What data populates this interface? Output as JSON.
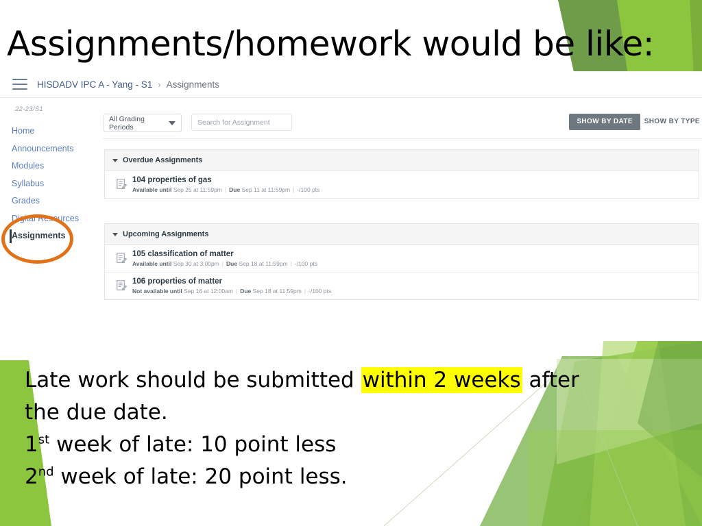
{
  "slide": {
    "title": "Assignments/homework would be like:",
    "accent_green_dark": "#6b9b47",
    "accent_green_light": "#8cc63f",
    "highlight_color": "#FFFF00",
    "annotation_color": "#E2721A"
  },
  "screenshot": {
    "breadcrumb": {
      "menu_icon": "hamburger-icon",
      "course": "HISDADV IPC A - Yang - S1",
      "separator": "›",
      "current": "Assignments"
    },
    "sidebar": {
      "term": "22-23/S1",
      "items": [
        {
          "label": "Home",
          "active": false
        },
        {
          "label": "Announcements",
          "active": false
        },
        {
          "label": "Modules",
          "active": false
        },
        {
          "label": "Syllabus",
          "active": false
        },
        {
          "label": "Grades",
          "active": false
        },
        {
          "label": "Digital Resources",
          "active": false
        },
        {
          "label": "Assignments",
          "active": true
        }
      ]
    },
    "toolbar": {
      "grading_period_value": "All Grading Periods",
      "search_placeholder": "Search for Assignment",
      "show_by_date": "SHOW BY DATE",
      "show_by_type": "SHOW BY TYPE",
      "active_view": "SHOW BY DATE"
    },
    "groups": [
      {
        "title": "Overdue Assignments",
        "rows": [
          {
            "name": "104 properties of gas",
            "available_label": "Available until",
            "available_value": "Sep 25 at 11:59pm",
            "due_label": "Due",
            "due_value": "Sep 11 at 11:59pm",
            "points": "-/100 pts"
          }
        ]
      },
      {
        "title": "Upcoming Assignments",
        "rows": [
          {
            "name": "105 classification of matter",
            "available_label": "Available until",
            "available_value": "Sep 30 at 3:00pm",
            "due_label": "Due",
            "due_value": "Sep 18 at 11:59pm",
            "points": "-/100 pts"
          },
          {
            "name": "106 properties of matter",
            "available_label": "Not available until",
            "available_value": "Sep 16 at 12:00am",
            "due_label": "Due",
            "due_value": "Sep 18 at 11:59pm",
            "points": "-/100 pts"
          }
        ]
      }
    ]
  },
  "body": {
    "line1_a": "Late work should be submitted ",
    "line1_hl": "within 2 weeks",
    "line1_b": " after",
    "line2": "the due date.",
    "line3_num": "1",
    "line3_sup": "st",
    "line3_rest": " week of late: 10 point less",
    "line4_num": "2",
    "line4_sup": "nd",
    "line4_rest": " week of late: 20 point less."
  }
}
